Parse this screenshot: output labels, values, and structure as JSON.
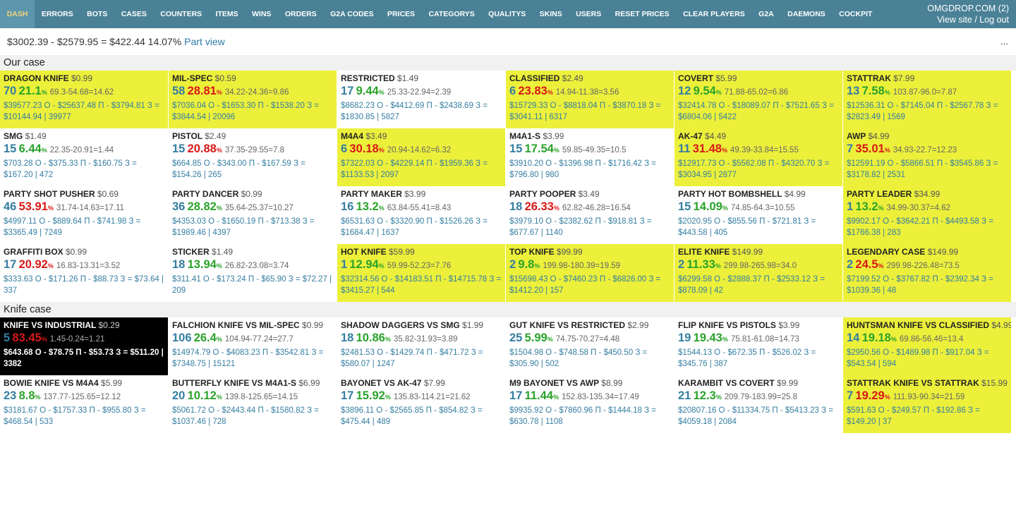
{
  "nav": {
    "items": [
      "DASH",
      "ERRORS",
      "BOTS",
      "CASES",
      "COUNTERS",
      "ITEMS",
      "WINS",
      "ORDERS",
      "G2A CODES",
      "PRICES",
      "CATEGORYS",
      "QUALITYS",
      "SKINS",
      "USERS",
      "RESET PRICES",
      "CLEAR PLAYERS",
      "G2A",
      "DAEMONS",
      "COCKPIT"
    ],
    "active": "DASH",
    "site_label": "OMGDROP.COM (2)",
    "view_site": "View site",
    "separator": " / ",
    "logout": "Log out"
  },
  "summary": {
    "text": "$3002.39 - $2579.95 = $422.44 14.07%",
    "link": "Part view",
    "more": "..."
  },
  "colors": {
    "nav_bg": "#4a8196",
    "highlight": "#ecf03a",
    "green": "#2aa22a",
    "red": "#d81818",
    "blue": "#357ea1"
  },
  "sections": [
    {
      "title": "Our case",
      "cells": [
        {
          "name": "DRAGON KNIFE",
          "price": "$0.99",
          "count": "70",
          "pct": "21.1",
          "pct_color": "green",
          "formula": "69.3-54.68=14.62",
          "calc": "$39577.23 О - $25637.48 П - $3794.81 З = $10144.94 | 39977",
          "style": "hl"
        },
        {
          "name": "MIL-SPEC",
          "price": "$0.59",
          "count": "58",
          "pct": "28.81",
          "pct_color": "red",
          "formula": "34.22-24.36=9.86",
          "calc": "$7036.04 О - $1653.30 П - $1538.20 З = $3844.54 | 20096",
          "style": "hl"
        },
        {
          "name": "RESTRICTED",
          "price": "$1.49",
          "count": "17",
          "pct": "9.44",
          "pct_color": "green",
          "formula": "25.33-22.94=2.39",
          "calc": "$8682.23 О - $4412.69 П - $2438.69 З = $1830.85 | 5827",
          "style": ""
        },
        {
          "name": "CLASSIFIED",
          "price": "$2.49",
          "count": "6",
          "pct": "23.83",
          "pct_color": "red",
          "formula": "14.94-11.38=3.56",
          "calc": "$15729.33 О - $8818.04 П - $3870.18 З = $3041.11 | 6317",
          "style": "hl"
        },
        {
          "name": "COVERT",
          "price": "$5.99",
          "count": "12",
          "pct": "9.54",
          "pct_color": "green",
          "formula": "71.88-65.02=6.86",
          "calc": "$32414.78 О - $18089.07 П - $7521.65 З = $6804.06 | 5422",
          "style": "hl"
        },
        {
          "name": "STATTRAK",
          "price": "$7.99",
          "count": "13",
          "pct": "7.58",
          "pct_color": "green",
          "formula": "103.87-96.0=7.87",
          "calc": "$12536.31 О - $7145.04 П - $2567.78 З = $2823.49 | 1569",
          "style": "hl"
        },
        {
          "name": "SMG",
          "price": "$1.49",
          "count": "15",
          "pct": "6.44",
          "pct_color": "green",
          "formula": "22.35-20.91=1.44",
          "calc": "$703.28 О - $375.33 П - $160.75 З = $167.20 | 472",
          "style": ""
        },
        {
          "name": "PISTOL",
          "price": "$2.49",
          "count": "15",
          "pct": "20.88",
          "pct_color": "red",
          "formula": "37.35-29.55=7.8",
          "calc": "$664.85 О - $343.00 П - $167.59 З = $154.26 | 265",
          "style": ""
        },
        {
          "name": "M4A4",
          "price": "$3.49",
          "count": "6",
          "pct": "30.18",
          "pct_color": "red",
          "formula": "20.94-14.62=6.32",
          "calc": "$7322.03 О - $4229.14 П - $1959.36 З = $1133.53 | 2097",
          "style": "hl"
        },
        {
          "name": "M4A1-S",
          "price": "$3.99",
          "count": "15",
          "pct": "17.54",
          "pct_color": "green",
          "formula": "59.85-49.35=10.5",
          "calc": "$3910.20 О - $1396.98 П - $1716.42 З = $796.80 | 980",
          "style": ""
        },
        {
          "name": "AK-47",
          "price": "$4.49",
          "count": "11",
          "pct": "31.48",
          "pct_color": "red",
          "formula": "49.39-33.84=15.55",
          "calc": "$12917.73 О - $5562.08 П - $4320.70 З = $3034.95 | 2877",
          "style": "hl"
        },
        {
          "name": "AWP",
          "price": "$4.99",
          "count": "7",
          "pct": "35.01",
          "pct_color": "red",
          "formula": "34.93-22.7=12.23",
          "calc": "$12591.19 О - $5866.51 П - $3545.86 З = $3178.82 | 2531",
          "style": "hl"
        },
        {
          "name": "PARTY SHOT PUSHER",
          "price": "$0.69",
          "count": "46",
          "pct": "53.91",
          "pct_color": "red",
          "formula": "31.74-14.63=17.11",
          "calc": "$4997.11 О - $889.64 П - $741.98 З = $3365.49 | 7249",
          "style": ""
        },
        {
          "name": "PARTY DANCER",
          "price": "$0.99",
          "count": "36",
          "pct": "28.82",
          "pct_color": "green",
          "formula": "35.64-25.37=10.27",
          "calc": "$4353.03 О - $1650.19 П - $713.38 З = $1989.46 | 4397",
          "style": ""
        },
        {
          "name": "PARTY MAKER",
          "price": "$3.99",
          "count": "16",
          "pct": "13.2",
          "pct_color": "green",
          "formula": "63.84-55.41=8.43",
          "calc": "$6531.63 О - $3320.90 П - $1526.26 З = $1684.47 | 1637",
          "style": ""
        },
        {
          "name": "PARTY POOPER",
          "price": "$3.49",
          "count": "18",
          "pct": "26.33",
          "pct_color": "red",
          "formula": "62.82-46.28=16.54",
          "calc": "$3979.10 О - $2382.62 П - $918.81 З = $677.67 | 1140",
          "style": ""
        },
        {
          "name": "PARTY HOT BOMBSHELL",
          "price": "$4.99",
          "count": "15",
          "pct": "14.09",
          "pct_color": "green",
          "formula": "74.85-64.3=10.55",
          "calc": "$2020.95 О - $855.56 П - $721.81 З = $443.58 | 405",
          "style": ""
        },
        {
          "name": "PARTY LEADER",
          "price": "$34.99",
          "count": "1",
          "pct": "13.2",
          "pct_color": "green",
          "formula": "34.99-30.37=4.62",
          "calc": "$9902.17 О - $3642.21 П - $4493.58 З = $1766.38 | 283",
          "style": "hl"
        },
        {
          "name": "GRAFFITI BOX",
          "price": "$0.99",
          "count": "17",
          "pct": "20.92",
          "pct_color": "red",
          "formula": "16.83-13.31=3.52",
          "calc": "$333.63 О - $171.26 П - $88.73 З = $73.64 | 337",
          "style": ""
        },
        {
          "name": "STICKER",
          "price": "$1.49",
          "count": "18",
          "pct": "13.94",
          "pct_color": "green",
          "formula": "26.82-23.08=3.74",
          "calc": "$311.41 О - $173.24 П - $65.90 З = $72.27 | 209",
          "style": ""
        },
        {
          "name": "HOT KNIFE",
          "price": "$59.99",
          "count": "1",
          "pct": "12.94",
          "pct_color": "green",
          "formula": "59.99-52.23=7.76",
          "calc": "$32314.56 О - $14183.51 П - $14715.78 З = $3415.27 | 544",
          "style": "hl"
        },
        {
          "name": "TOP KNIFE",
          "price": "$99.99",
          "count": "2",
          "pct": "9.8",
          "pct_color": "green",
          "formula": "199.98-180.39=19.59",
          "calc": "$15698.43 О - $7460.23 П - $6826.00 З = $1412.20 | 157",
          "style": "hl"
        },
        {
          "name": "ELITE KNIFE",
          "price": "$149.99",
          "count": "2",
          "pct": "11.33",
          "pct_color": "green",
          "formula": "299.98-265.98=34.0",
          "calc": "$6299.58 О - $2888.37 П - $2533.12 З = $878.09 | 42",
          "style": "hl"
        },
        {
          "name": "LEGENDARY CASE",
          "price": "$149.99",
          "count": "2",
          "pct": "24.5",
          "pct_color": "red",
          "formula": "299.98-226.48=73.5",
          "calc": "$7199.52 О - $3767.82 П - $2392.34 З = $1039.36 | 48",
          "style": "hl"
        }
      ]
    },
    {
      "title": "Knife case",
      "cells": [
        {
          "name": "KNIFE VS INDUSTRIAL",
          "price": "$0.29",
          "count": "5",
          "pct": "83.45",
          "pct_color": "red",
          "formula": "1.45-0.24=1.21",
          "calc": "$643.68 О - $78.75 П - $53.73 З = $511.20 | 3382",
          "style": "dark"
        },
        {
          "name": "FALCHION KNIFE VS MIL-SPEC",
          "price": "$0.99",
          "count": "106",
          "pct": "26.4",
          "pct_color": "green",
          "formula": "104.94-77.24=27.7",
          "calc": "$14974.79 О - $4083.23 П - $3542.81 З = $7348.75 | 15121",
          "style": ""
        },
        {
          "name": "SHADOW DAGGERS VS SMG",
          "price": "$1.99",
          "count": "18",
          "pct": "10.86",
          "pct_color": "green",
          "formula": "35.82-31.93=3.89",
          "calc": "$2481.53 О - $1429.74 П - $471.72 З = $580.07 | 1247",
          "style": ""
        },
        {
          "name": "GUT KNIFE VS RESTRICTED",
          "price": "$2.99",
          "count": "25",
          "pct": "5.99",
          "pct_color": "green",
          "formula": "74.75-70.27=4.48",
          "calc": "$1504.98 О - $748.58 П - $450.50 З = $305.90 | 502",
          "style": ""
        },
        {
          "name": "FLIP KNIFE VS PISTOLS",
          "price": "$3.99",
          "count": "19",
          "pct": "19.43",
          "pct_color": "green",
          "formula": "75.81-61.08=14.73",
          "calc": "$1544.13 О - $672.35 П - $526.02 З = $345.76 | 387",
          "style": ""
        },
        {
          "name": "HUNTSMAN KNIFE VS CLASSIFIED",
          "price": "$4.99",
          "count": "14",
          "pct": "19.18",
          "pct_color": "green",
          "formula": "69.86-56.46=13.4",
          "calc": "$2950.56 О - $1489.98 П - $917.04 З = $543.54 | 594",
          "style": "hl"
        },
        {
          "name": "BOWIE KNIFE VS M4A4",
          "price": "$5.99",
          "count": "23",
          "pct": "8.8",
          "pct_color": "green",
          "formula": "137.77-125.65=12.12",
          "calc": "$3181.67 О - $1757.33 П - $955.80 З = $468.54 | 533",
          "style": ""
        },
        {
          "name": "BUTTERFLY KNIFE VS M4A1-S",
          "price": "$6.99",
          "count": "20",
          "pct": "10.12",
          "pct_color": "green",
          "formula": "139.8-125.65=14.15",
          "calc": "$5061.72 О - $2443.44 П - $1580.82 З = $1037.46 | 728",
          "style": ""
        },
        {
          "name": "BAYONET VS AK-47",
          "price": "$7.99",
          "count": "17",
          "pct": "15.92",
          "pct_color": "green",
          "formula": "135.83-114.21=21.62",
          "calc": "$3896.11 О - $2565.85 П - $854.82 З = $475.44 | 489",
          "style": ""
        },
        {
          "name": "M9 BAYONET VS AWP",
          "price": "$8.99",
          "count": "17",
          "pct": "11.44",
          "pct_color": "green",
          "formula": "152.83-135.34=17.49",
          "calc": "$9935.92 О - $7860.96 П - $1444.18 З = $630.78 | 1108",
          "style": ""
        },
        {
          "name": "KARAMBIT VS COVERT",
          "price": "$9.99",
          "count": "21",
          "pct": "12.3",
          "pct_color": "green",
          "formula": "209.79-183.99=25.8",
          "calc": "$20807.16 О - $11334.75 П - $5413.23 З = $4059.18 | 2084",
          "style": ""
        },
        {
          "name": "STATTRAK KNIFE VS STATTRAK",
          "price": "$15.99",
          "count": "7",
          "pct": "19.29",
          "pct_color": "red",
          "formula": "111.93-90.34=21.59",
          "calc": "$591.63 О - $249.57 П - $192.86 З = $149.20 | 37",
          "style": "hl"
        }
      ]
    }
  ]
}
